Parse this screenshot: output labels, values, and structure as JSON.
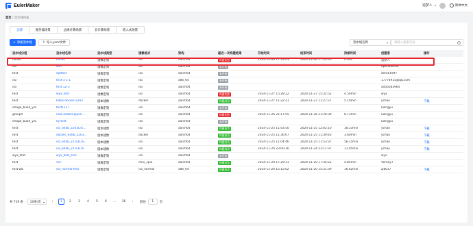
{
  "app": {
    "logo_text": "EulerMaker",
    "user_name": "追梦人",
    "lang_label": "简体中文"
  },
  "breadcrumb": {
    "home": "首页",
    "sep": "/",
    "current": "流水线列表"
  },
  "tabs": [
    "全部",
    "服务器场景",
    "边缘计算场景",
    "云计算场景",
    "嵌入式场景"
  ],
  "toolbar": {
    "add_label": "添加流水线",
    "import_label": "导入yaml文件"
  },
  "filter": {
    "select_value": "流水线名称",
    "search_placeholder": "请输入搜索内容"
  },
  "columns": [
    "流水线分组",
    "流水线名称",
    "流水线类型",
    "镜像格式",
    "架构",
    "最近一次构建结果",
    "开始时间",
    "结束时间",
    "持续时间",
    "创建者",
    "操作"
  ],
  "rows": [
    {
      "group": "mkiso",
      "name": "mkiso",
      "type": "镜像定制",
      "format": "iso",
      "arch": "aarch64",
      "result": "构建失败",
      "start": "2024-12-06 17:33:43",
      "end": "2024-12-06 17:33:43",
      "duration": "0.00s",
      "creator": "追梦人",
      "op": ""
    },
    {
      "group": "iso",
      "name": "MaT",
      "type": "镜像定制",
      "format": "iso",
      "arch": "aarch64",
      "result": "未开始",
      "start": "",
      "end": "",
      "duration": "",
      "creator": "openEulerM",
      "op": ""
    },
    {
      "group": "test",
      "name": "dyttest",
      "type": "镜像定制",
      "format": "iso",
      "arch": "aarch64",
      "result": "未开始",
      "start": "",
      "end": "",
      "duration": "",
      "creator": "derek1997",
      "op": ""
    },
    {
      "group": "iso",
      "name": "test-1-1-1",
      "type": "镜像定制",
      "format": "iso",
      "arch": "x86_64",
      "result": "未开始",
      "start": "",
      "end": "",
      "duration": "",
      "creator": "17774915@qq.com",
      "op": ""
    },
    {
      "group": "iso",
      "name": "test-12-3",
      "type": "镜像定制",
      "format": "iso",
      "arch": "aarch64",
      "result": "未开始",
      "start": "",
      "end": "",
      "duration": "",
      "creator": "ad56583964",
      "op": ""
    },
    {
      "group": "test",
      "name": "wyx_test",
      "type": "镜像定制",
      "format": "iso",
      "arch": "aarch64",
      "result": "构建失败",
      "start": "2024-11-27 15:28:22",
      "end": "2024-11-27 15:32:52",
      "duration": "4.50min",
      "creator": "wyx",
      "op": ""
    },
    {
      "group": "test",
      "name": "64kb-docker-2203",
      "type": "版本镜像",
      "format": "docker",
      "arch": "aarch64",
      "result": "构建成功",
      "start": "2024-11-27 11:22:21",
      "end": "2024-11-27 11:27:27",
      "duration": "5.10min",
      "creator": "ychao",
      "op": "下载"
    },
    {
      "group": "image_build_ysc",
      "name": "test1127",
      "type": "镜像定制",
      "format": "iso",
      "arch": "aarch64",
      "result": "未开始",
      "start": "",
      "end": "",
      "duration": "",
      "creator": "lulingyu",
      "op": ""
    },
    {
      "group": "groupA",
      "name": "new-added-pipeli...",
      "type": "镜像定制",
      "format": "iso",
      "arch": "aarch64",
      "result": "构建失败",
      "start": "2024-11-26 21:17:55",
      "end": "2024-11-26 21:26:39",
      "duration": "8.73min",
      "creator": "lulingyu",
      "op": ""
    },
    {
      "group": "image_build_ysc",
      "name": "lly-test",
      "type": "镜像定制",
      "format": "iso",
      "arch": "aarch64",
      "result": "未开始",
      "start": "",
      "end": "",
      "duration": "",
      "creator": "lulingyu",
      "op": ""
    },
    {
      "group": "test",
      "name": "iso_64kb_2203LTS...",
      "type": "版本镜像",
      "format": "iso",
      "arch": "aarch64",
      "result": "构建成功",
      "start": "2024-11-25 11:43:50",
      "end": "2024-11-25 12:02:10",
      "duration": "18.33min",
      "creator": "ychao",
      "op": "下载"
    },
    {
      "group": "test",
      "name": "docker_64kb_2203...",
      "type": "版本镜像",
      "format": "docker",
      "arch": "aarch64",
      "result": "构建成功",
      "start": "2024-11-25 11:36:07",
      "end": "2024-11-25 11:39:43",
      "duration": "3.60min",
      "creator": "ychao",
      "op": "下载"
    },
    {
      "group": "test",
      "name": "iso_64kb_22.03LTS...",
      "type": "版本镜像",
      "format": "iso",
      "arch": "aarch64",
      "result": "构建成功",
      "start": "2024-11-25 11:04:46",
      "end": "2024-11-25 11:53:37",
      "duration": "58.25min",
      "creator": "ychao",
      "op": "下载"
    },
    {
      "group": "test",
      "name": "iso_64kb_22.03LTS",
      "type": "版本镜像",
      "format": "iso",
      "arch": "aarch64",
      "result": "构建成功",
      "start": "2024-11-24 23:00:30",
      "end": "2024-11-24 23:11:37",
      "duration": "11.05min",
      "creator": "ychao",
      "op": "下载"
    },
    {
      "group": "wyx_test",
      "name": "wyx_test_arm",
      "type": "镜像定制",
      "format": "iso",
      "arch": "aarch64",
      "result": "未开始",
      "start": "",
      "end": "",
      "duration": "",
      "creator": "wyx",
      "op": ""
    },
    {
      "group": "test",
      "name": "ve7",
      "type": "镜像定制",
      "format": "mini_cpio",
      "arch": "aarch64",
      "result": "构建成功",
      "start": "2024-11-20 17:29:31",
      "end": "2024-11-20 17:34:22",
      "duration": "4.85min",
      "creator": "Verney7",
      "op": ""
    },
    {
      "group": "test-zjb",
      "name": "iso_normal-test",
      "type": "镜像定制",
      "format": "iso_normal",
      "arch": "x86_64",
      "result": "构建成功",
      "start": "2024-11-20 15:15:02",
      "end": "2024-11-20 15:31:39",
      "duration": "16.62min",
      "creator": "zjb617",
      "op": "下载"
    }
  ],
  "status_colors": {
    "构建失败": "#e3242b",
    "未开始": "#9aa0a6",
    "构建成功": "#2eb82e"
  },
  "pagination": {
    "total": "共 719 条",
    "page_size": "20条/页",
    "pages": [
      "1",
      "2",
      "3",
      "4",
      "5",
      "6",
      "...",
      "36"
    ],
    "current": "1",
    "goto_label": "前往",
    "goto_value": "1",
    "page_unit": "页"
  }
}
